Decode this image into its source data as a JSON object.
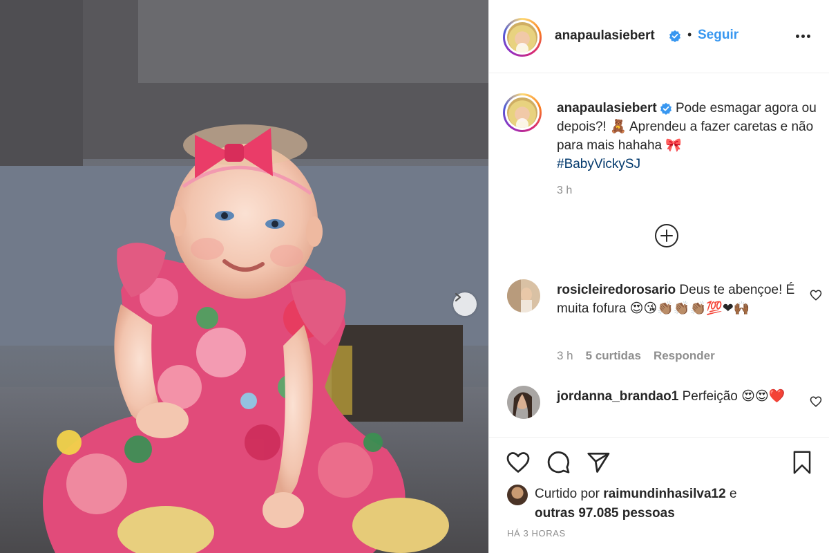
{
  "post": {
    "author": "anapaulasiebert",
    "follow_label": "Seguir",
    "separator": "•",
    "caption": {
      "text": "Pode esmagar agora ou depois?! 🧸 Aprendeu a fazer caretas e não para mais hahaha 🎀",
      "hashtag": "#BabyVickySJ",
      "time": "3 h"
    }
  },
  "comments": [
    {
      "user": "rosicleiredorosario",
      "text": "Deus te abençoe! É muita fofura 😍😘👏🏽👏🏽👏🏽💯❤🙌🏾",
      "time": "3 h",
      "likes": "5 curtidas",
      "reply": "Responder"
    },
    {
      "user": "jordanna_brandao1",
      "text": "Perfeição 😍😍❤️"
    }
  ],
  "likes": {
    "prefix": "Curtido por",
    "user": "raimundinhasilva12",
    "connector": "e",
    "others": "outras 97.085 pessoas"
  },
  "posted_ago": "HÁ 3 HORAS",
  "colors": {
    "accent_blue": "#3897f0",
    "hashtag": "#00376b",
    "text": "#262626",
    "muted": "#8e8e8e",
    "border": "#efefef"
  },
  "icons": [
    "verified-badge-icon",
    "more-options-icon",
    "add-comment-icon",
    "heart-icon",
    "comment-icon",
    "share-icon",
    "bookmark-icon",
    "chevron-right-icon"
  ]
}
